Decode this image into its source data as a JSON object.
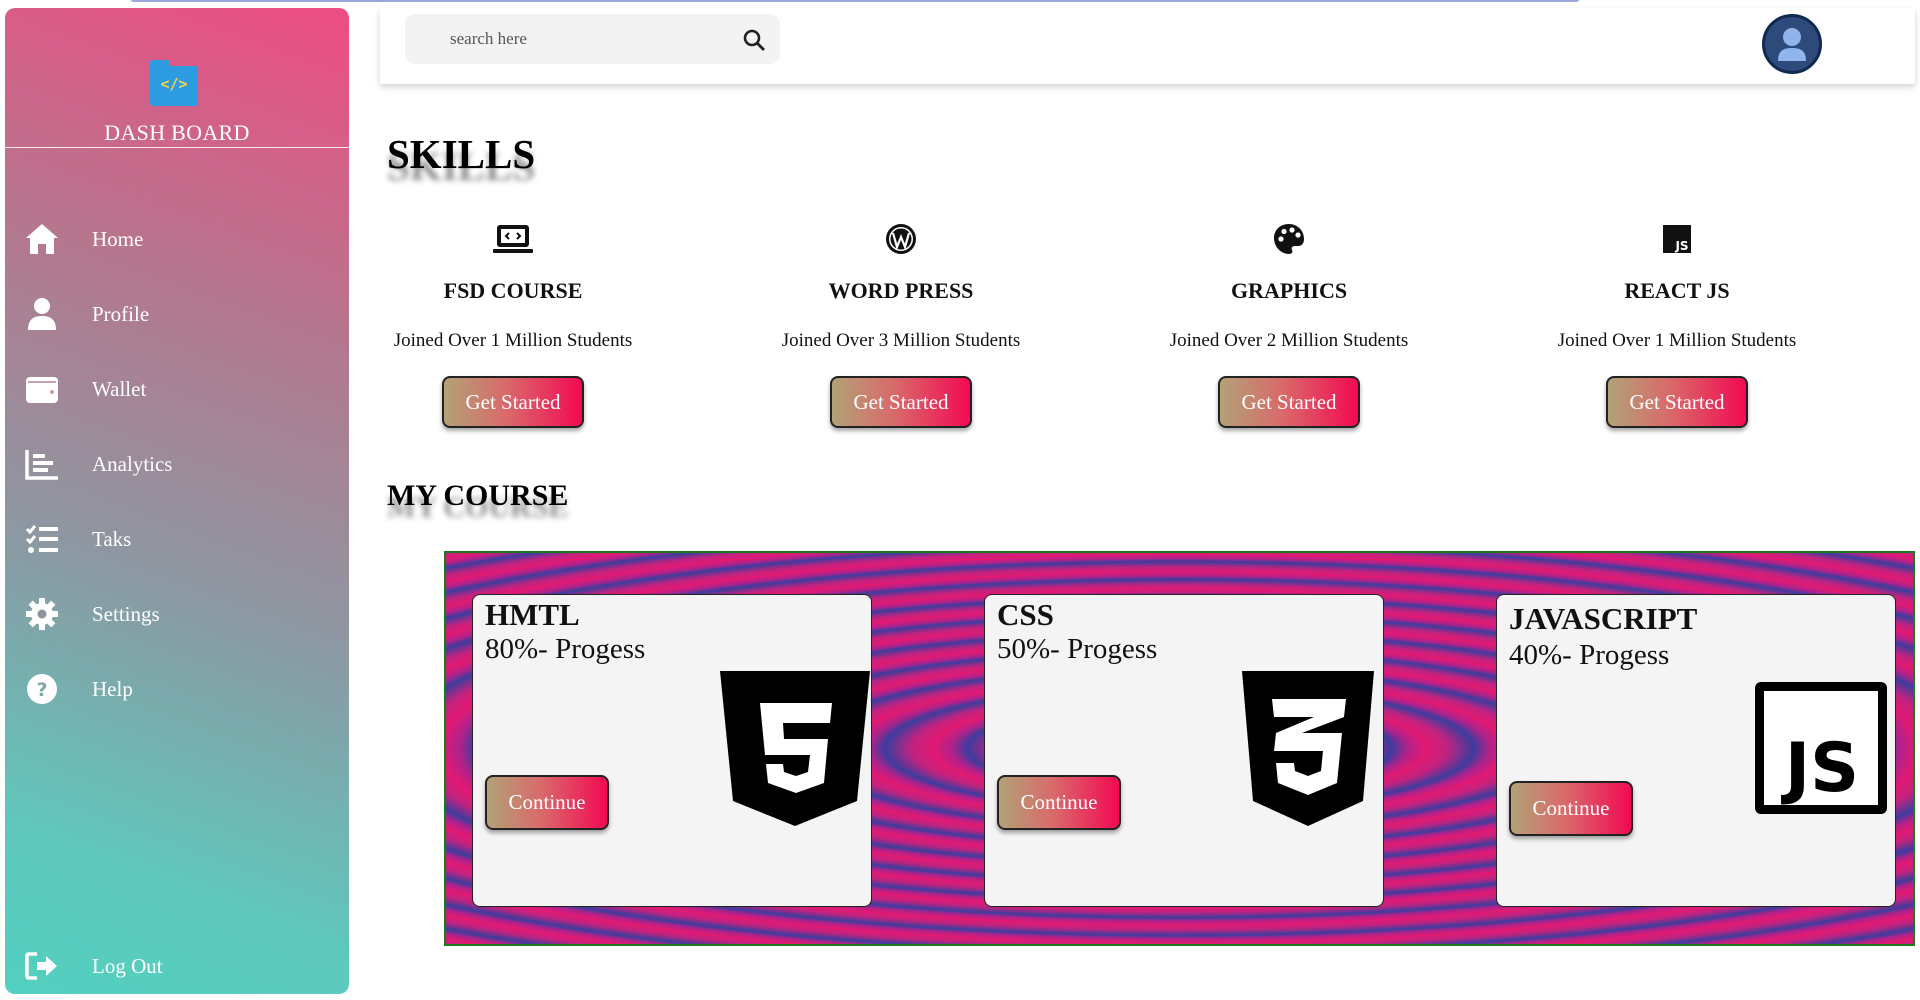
{
  "brand": {
    "title": "DASH BOARD",
    "logo_text": "</>",
    "logo_icon": "code-folder-icon"
  },
  "sidebar": {
    "items": [
      {
        "label": "Home",
        "icon": "home-icon"
      },
      {
        "label": "Profile",
        "icon": "user-icon"
      },
      {
        "label": "Wallet",
        "icon": "wallet-icon"
      },
      {
        "label": "Analytics",
        "icon": "bar-chart-icon"
      },
      {
        "label": "Taks",
        "icon": "task-list-icon"
      },
      {
        "label": "Settings",
        "icon": "gear-icon"
      },
      {
        "label": "Help",
        "icon": "question-icon"
      }
    ],
    "logout": {
      "label": "Log Out",
      "icon": "logout-icon"
    }
  },
  "header": {
    "search": {
      "placeholder": "search here",
      "value": "",
      "icon": "search-icon"
    },
    "avatar_icon": "user-avatar-icon"
  },
  "skills": {
    "title": "SKILLS",
    "items": [
      {
        "name": "FSD COURSE",
        "desc": "Joined Over 1 Million Students",
        "button": "Get Started",
        "icon": "laptop-code-icon"
      },
      {
        "name": "WORD PRESS",
        "desc": "Joined Over 3 Million Students",
        "button": "Get Started",
        "icon": "wordpress-icon"
      },
      {
        "name": "GRAPHICS",
        "desc": "Joined Over 2 Million Students",
        "button": "Get Started",
        "icon": "palette-icon"
      },
      {
        "name": "REACT JS",
        "desc": "Joined Over 1 Million Students",
        "button": "Get Started",
        "icon": "js-square-icon"
      }
    ]
  },
  "my_course": {
    "title": "MY COURSE",
    "courses": [
      {
        "name": "HMTL",
        "progress": "80%- Progess",
        "button": "Continue",
        "icon": "html5-icon"
      },
      {
        "name": "CSS",
        "progress": "50%- Progess",
        "button": "Continue",
        "icon": "css3-icon"
      },
      {
        "name": "JAVASCRIPT",
        "progress": "40%- Progess",
        "button": "Continue",
        "icon": "javascript-icon"
      }
    ]
  },
  "colors": {
    "sidebar_top": "#ee4c83",
    "sidebar_bottom": "#52d0c0",
    "button_start": "#b2a277",
    "button_end": "#f20a52",
    "strip_pink": "#e11a73",
    "strip_blue": "#3d3c9e"
  }
}
